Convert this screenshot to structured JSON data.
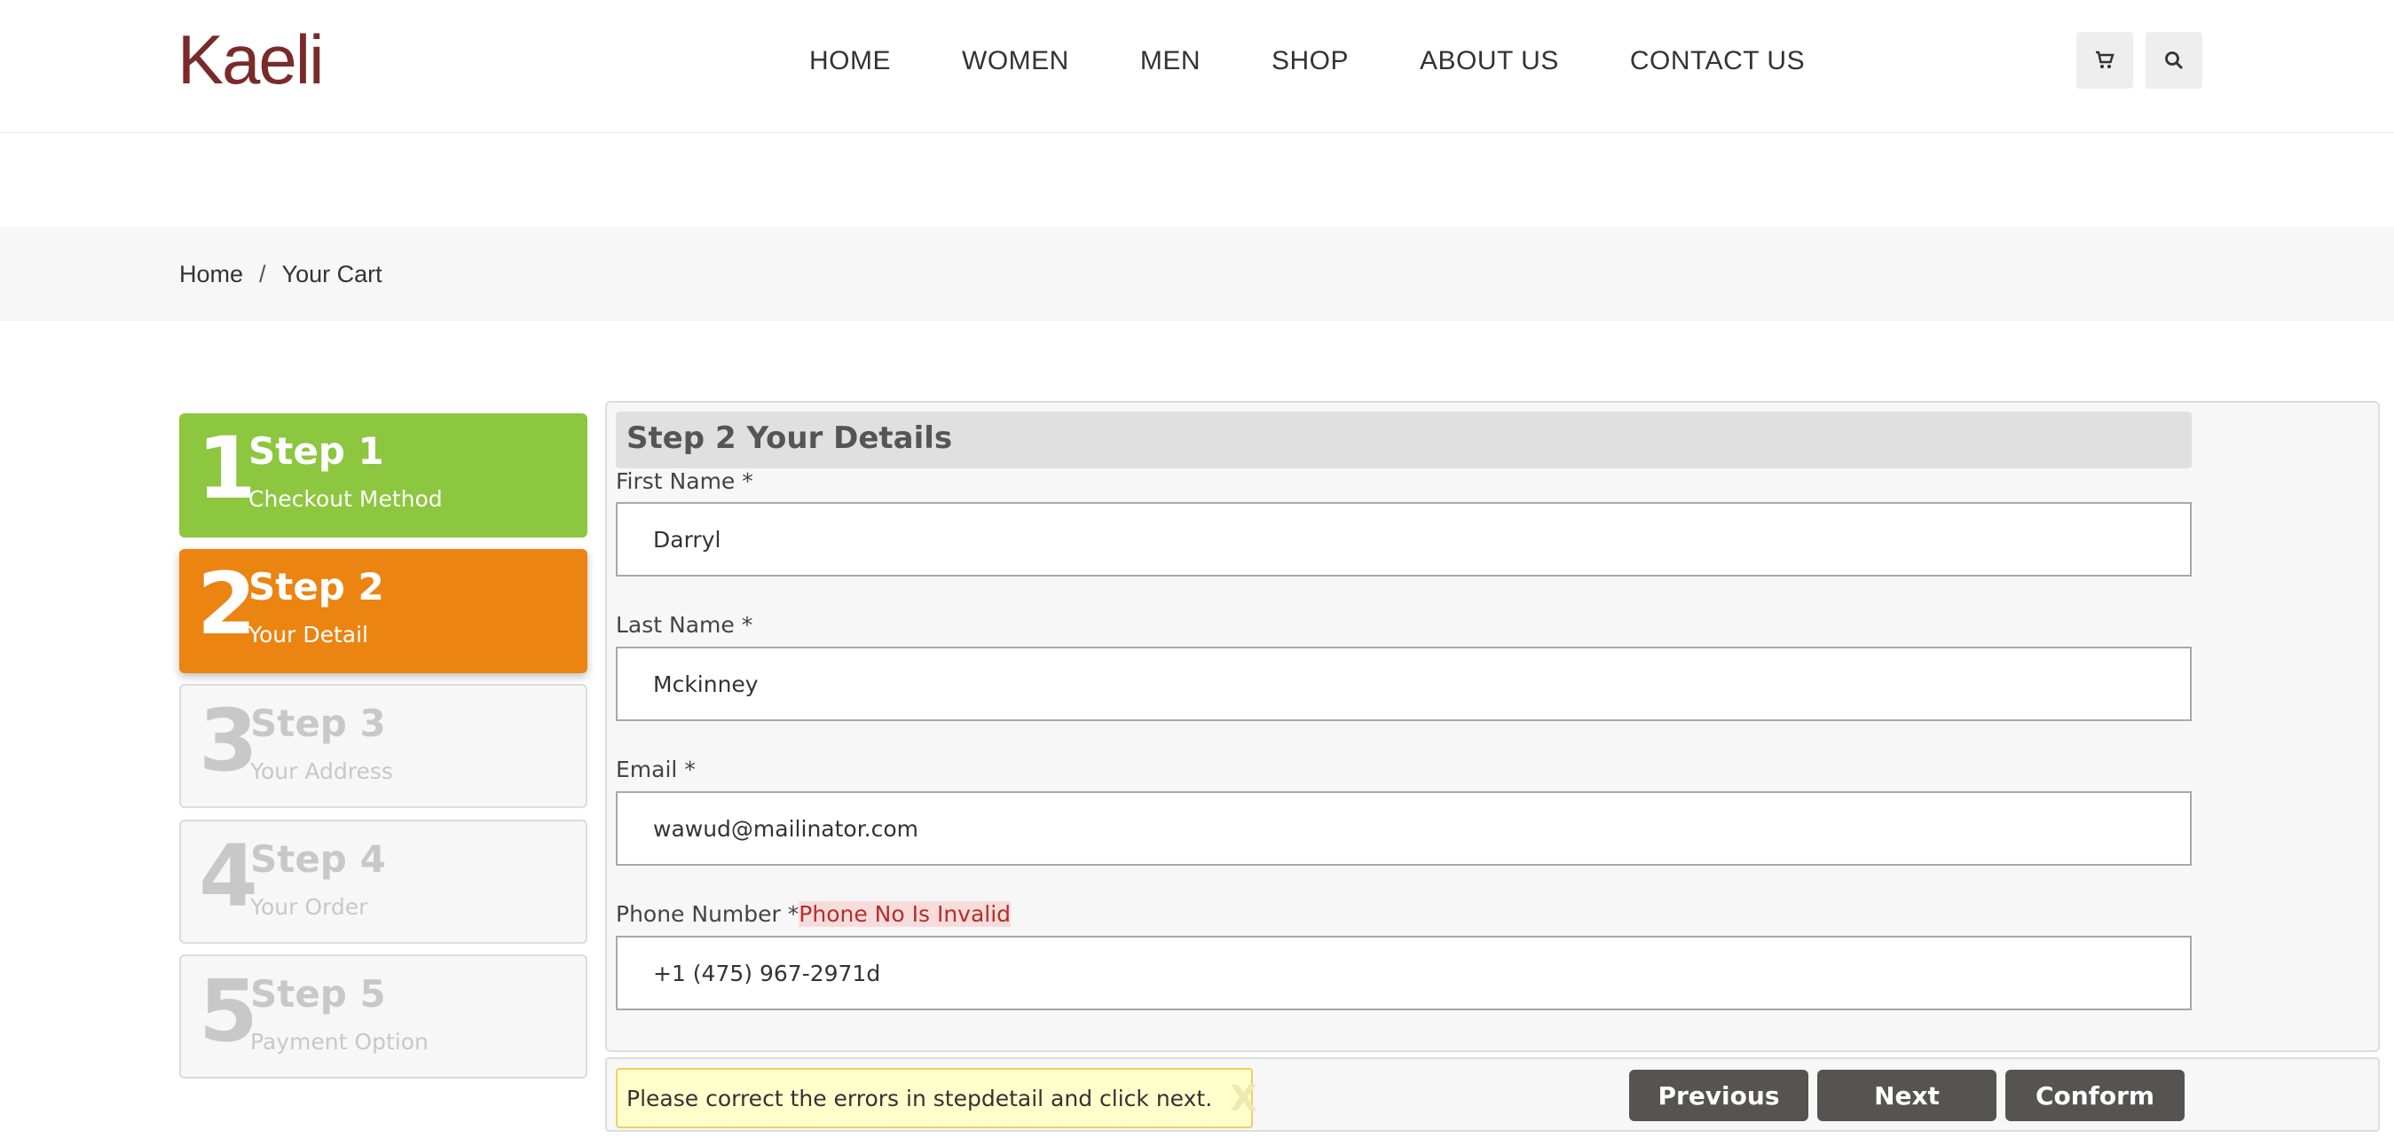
{
  "header": {
    "logo": "Kaeli",
    "nav": [
      "HOME",
      "WOMEN",
      "MEN",
      "SHOP",
      "ABOUT US",
      "CONTACT US"
    ],
    "icons": [
      "cart-icon",
      "search-icon"
    ]
  },
  "breadcrumb": {
    "home": "Home",
    "separator": "/",
    "current": "Your Cart"
  },
  "steps": [
    {
      "num": "1",
      "title": "Step 1",
      "sub": "Checkout Method",
      "state": "done"
    },
    {
      "num": "2",
      "title": "Step 2",
      "sub": "Your Detail",
      "state": "active"
    },
    {
      "num": "3",
      "title": "Step 3",
      "sub": "Your Address",
      "state": "pending"
    },
    {
      "num": "4",
      "title": "Step 4",
      "sub": "Your Order",
      "state": "pending"
    },
    {
      "num": "5",
      "title": "Step 5",
      "sub": "Payment Option",
      "state": "pending"
    }
  ],
  "form": {
    "heading": "Step 2 Your Details",
    "first_name": {
      "label": "First Name",
      "required": "*",
      "value": "Darryl"
    },
    "last_name": {
      "label": "Last Name",
      "required": "*",
      "value": "Mckinney"
    },
    "email": {
      "label": "Email",
      "required": "*",
      "value": "wawud@mailinator.com"
    },
    "phone": {
      "label": "Phone Number",
      "required": "*",
      "error": "Phone No Is Invalid",
      "value": "+1 (475) 967-2971d"
    }
  },
  "alert": {
    "message": "Please correct the errors in stepdetail and click next.",
    "close": "X"
  },
  "buttons": {
    "previous": "Previous",
    "next": "Next",
    "confirm": "Conform"
  },
  "colors": {
    "step_done": "#8dc63f",
    "step_active": "#ec8412",
    "button": "#565353",
    "brand": "#7a2a2a",
    "error": "#b0302a"
  }
}
